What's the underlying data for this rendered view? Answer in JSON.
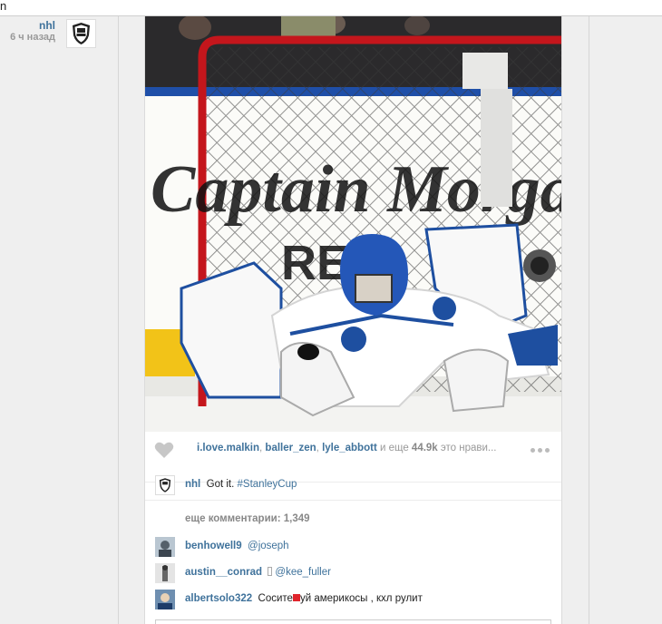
{
  "topbar": {
    "fragment": "n"
  },
  "author": {
    "username": "nhl",
    "time_ago": "6 ч назад",
    "avatar_icon": "nhl-logo-icon"
  },
  "post": {
    "likes": {
      "users": [
        "i.love.malkin",
        "baller_zen",
        "lyle_abbott"
      ],
      "sep1": ", ",
      "sep2": ", ",
      "mid": " и еще ",
      "count": "44.9k",
      "tail": " это нрави..."
    },
    "caption": {
      "username": "nhl",
      "text": "Got it. ",
      "hashtag": "#StanleyCup"
    },
    "more_comments_label": "еще комментарии: 1,349",
    "comments": [
      {
        "username": "benhowell9",
        "text": "@joseph"
      },
      {
        "username": "austin__conrad",
        "text": "@kee_fuller"
      },
      {
        "username": "albertsolo322",
        "text_before": "Сосите",
        "text_after": "уй америкосы , кхл рулит"
      }
    ]
  },
  "colors": {
    "link": "#3f729b",
    "net": "#c4161c",
    "jersey_blue": "#1e4fa0"
  }
}
